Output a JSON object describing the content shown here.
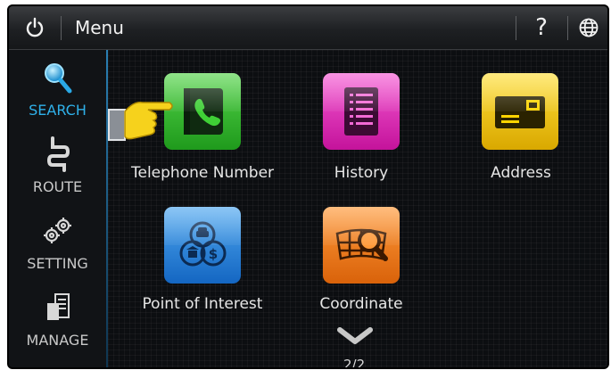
{
  "topbar": {
    "title": "Menu",
    "help_label": "?"
  },
  "sidebar": {
    "items": [
      {
        "label": "SEARCH",
        "icon": "magnifier-icon",
        "active": true
      },
      {
        "label": "ROUTE",
        "icon": "route-icon",
        "active": false
      },
      {
        "label": "SETTING",
        "icon": "gears-icon",
        "active": false
      },
      {
        "label": "MANAGE",
        "icon": "documents-icon",
        "active": false
      }
    ]
  },
  "tiles": [
    {
      "label": "Telephone Number",
      "icon": "phone-book-icon",
      "color": "#2fb52b"
    },
    {
      "label": "History",
      "icon": "list-icon",
      "color": "#e21fb8"
    },
    {
      "label": "Address",
      "icon": "envelope-icon",
      "color": "#f0c300"
    },
    {
      "label": "Point of Interest",
      "icon": "poi-icon",
      "color": "#1f7fd8"
    },
    {
      "label": "Coordinate",
      "icon": "globe-search-icon",
      "color": "#ef7a14"
    }
  ],
  "pager": {
    "text": "2/2"
  },
  "colors": {
    "accent": "#2fb1ea",
    "background": "#0b0d10"
  }
}
